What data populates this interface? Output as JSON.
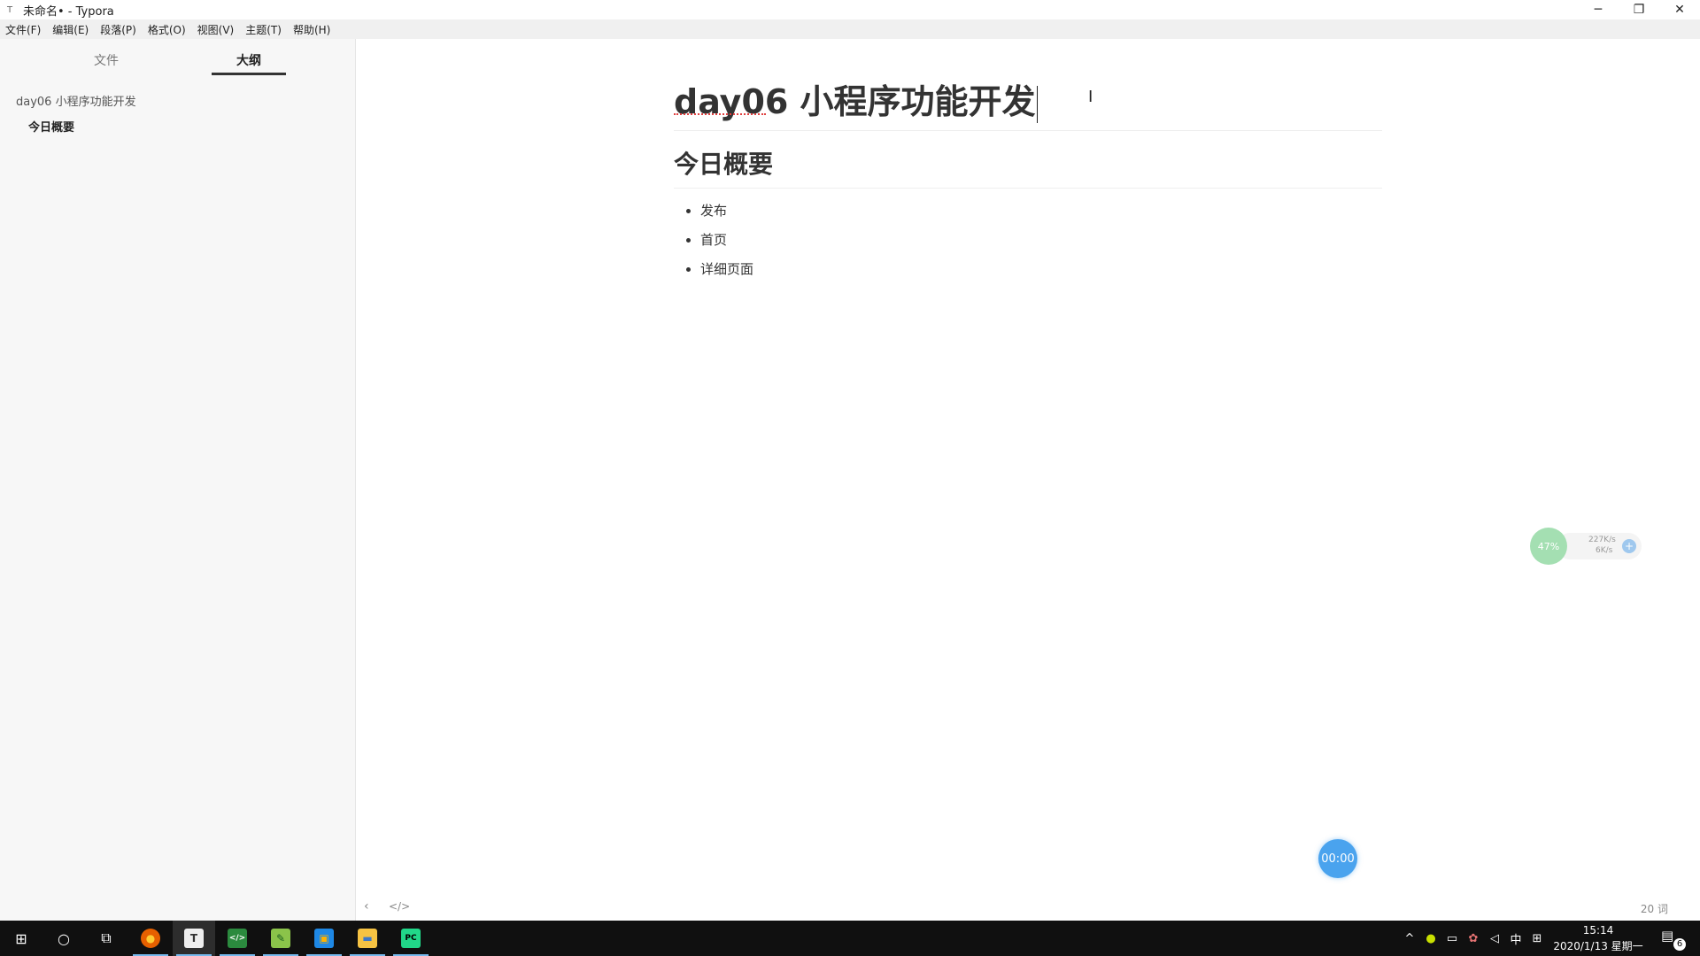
{
  "window": {
    "title": "未命名• - Typora",
    "app_icon": "T",
    "controls": {
      "minimize": "─",
      "restore": "❐",
      "close": "✕"
    }
  },
  "menu": [
    "文件(F)",
    "编辑(E)",
    "段落(P)",
    "格式(O)",
    "视图(V)",
    "主题(T)",
    "帮助(H)"
  ],
  "sidebar": {
    "tabs": [
      {
        "label": "文件",
        "active": false
      },
      {
        "label": "大纲",
        "active": true
      }
    ],
    "outline": [
      {
        "label": "day06 小程序功能开发",
        "level": 1
      },
      {
        "label": "今日概要",
        "level": 2
      }
    ]
  },
  "document": {
    "h1": "day06 小程序功能开发",
    "h2": "今日概要",
    "list": [
      "发布",
      "首页",
      "详细页面"
    ]
  },
  "status": {
    "back_icon": "‹",
    "code_icon": "</>",
    "word_count": "20 词"
  },
  "timer": {
    "label": "00:00"
  },
  "net_widget": {
    "percent": "47%",
    "upload": "227K/s",
    "download": "6K/s",
    "colors": {
      "circle": "#a4dfb2",
      "bar": "#f4f4f4"
    }
  },
  "taskbar": {
    "apps": [
      {
        "name": "windows-start-icon",
        "glyph": "⊞"
      },
      {
        "name": "cortana-search-icon",
        "glyph": "○"
      },
      {
        "name": "task-view-icon",
        "glyph": "⧉"
      },
      {
        "name": "firefox-icon",
        "glyph": "●"
      },
      {
        "name": "typora-icon",
        "glyph": "T"
      },
      {
        "name": "code-editor-icon",
        "glyph": "</>"
      },
      {
        "name": "notepad-plus-icon",
        "glyph": "✎"
      },
      {
        "name": "remote-app-icon",
        "glyph": "▣"
      },
      {
        "name": "file-explorer-icon",
        "glyph": "▬"
      },
      {
        "name": "pycharm-icon",
        "glyph": "PC"
      }
    ],
    "tray": {
      "chevron": "^",
      "ime": "中",
      "grid": "⊞"
    },
    "clock": {
      "time": "15:14",
      "date": "2020/1/13 星期一"
    },
    "notifications": "6"
  },
  "colors": {
    "accent": "#4aa3ee",
    "taskbar": "#101010",
    "taskbar_highlight": "#76b9ed"
  }
}
